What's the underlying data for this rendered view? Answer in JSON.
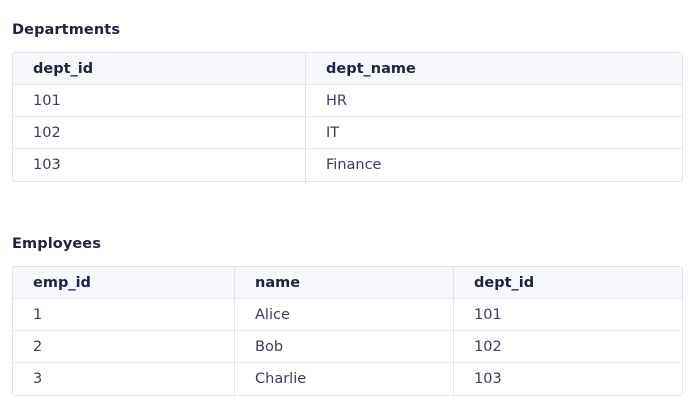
{
  "departments": {
    "title": "Departments",
    "columns": [
      "dept_id",
      "dept_name"
    ],
    "rows": [
      [
        "101",
        "HR"
      ],
      [
        "102",
        "IT"
      ],
      [
        "103",
        "Finance"
      ]
    ]
  },
  "employees": {
    "title": "Employees",
    "columns": [
      "emp_id",
      "name",
      "dept_id"
    ],
    "rows": [
      [
        "1",
        "Alice",
        "101"
      ],
      [
        "2",
        "Bob",
        "102"
      ],
      [
        "3",
        "Charlie",
        "103"
      ]
    ]
  }
}
